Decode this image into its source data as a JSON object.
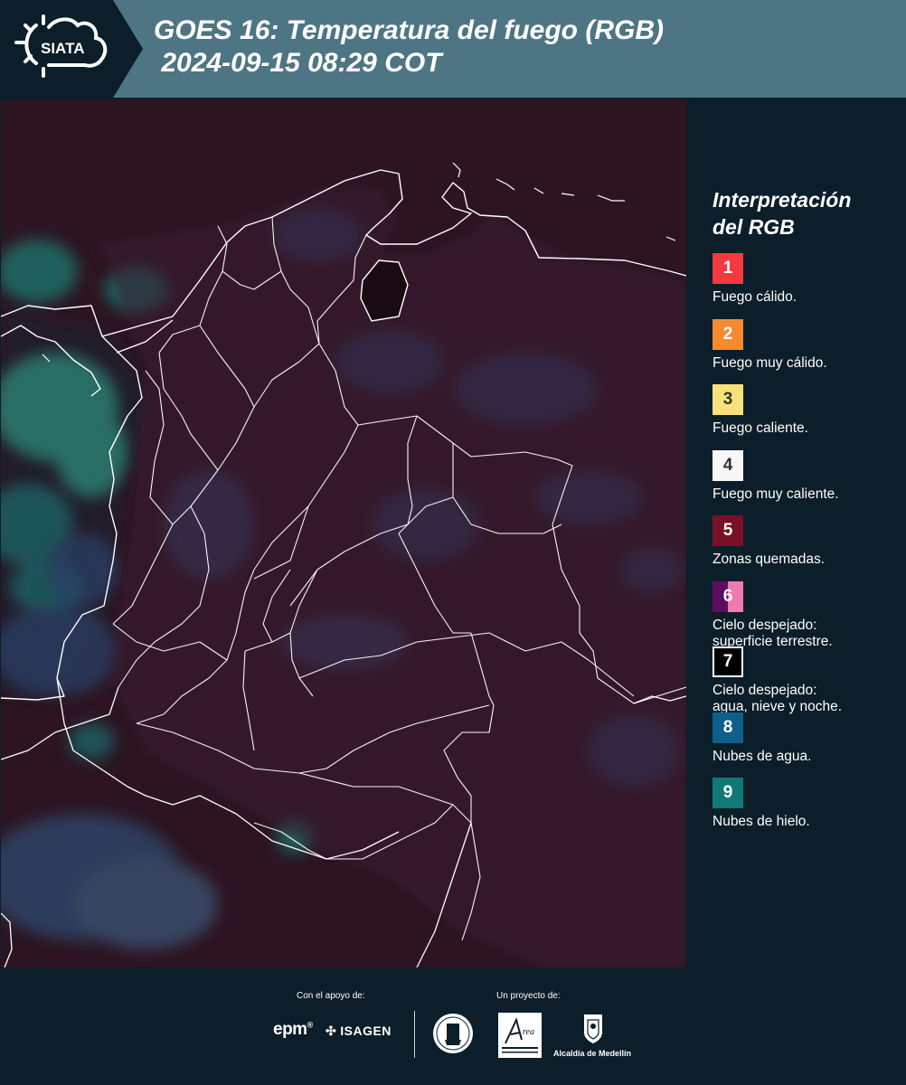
{
  "header": {
    "logo_text": "SIATA",
    "title_line1": "GOES 16: Temperatura del fuego (RGB)",
    "title_line2": " 2024-09-15 08:29 COT"
  },
  "legend": {
    "title": "Interpretación\ndel RGB",
    "items": [
      {
        "number": "1",
        "text": "Fuego cálido.",
        "color": "#f43a3f"
      },
      {
        "number": "2",
        "text": "Fuego muy cálido.",
        "color": "#f58a2e"
      },
      {
        "number": "3",
        "text": "Fuego caliente.",
        "color": "#f7e27a"
      },
      {
        "number": "4",
        "text": "Fuego muy caliente.",
        "color": "#f7f7f7"
      },
      {
        "number": "5",
        "text": "Zonas quemadas.",
        "color": "#7a1027"
      },
      {
        "number": "6",
        "text": "Cielo despejado:\nsuperficie terrestre.",
        "color": "#5c0d5e",
        "color2": "#f07bb0"
      },
      {
        "number": "7",
        "text": "Cielo despejado:\nagua, nieve y noche.",
        "color": "#000000"
      },
      {
        "number": "8",
        "text": "Nubes de agua.",
        "color": "#0e5f8c"
      },
      {
        "number": "9",
        "text": "Nubes de hielo.",
        "color": "#0f7a75"
      }
    ]
  },
  "footer": {
    "support_label": "Con el apoyo de:",
    "project_label": "Un proyecto de:",
    "epm": "epm",
    "isagen": "ISAGEN",
    "alcaldia": "Alcaldía de Medellín"
  },
  "colors": {
    "header_band": "#4e7583",
    "page_bg": "#0b1e29",
    "map_base": "#2c1521"
  }
}
